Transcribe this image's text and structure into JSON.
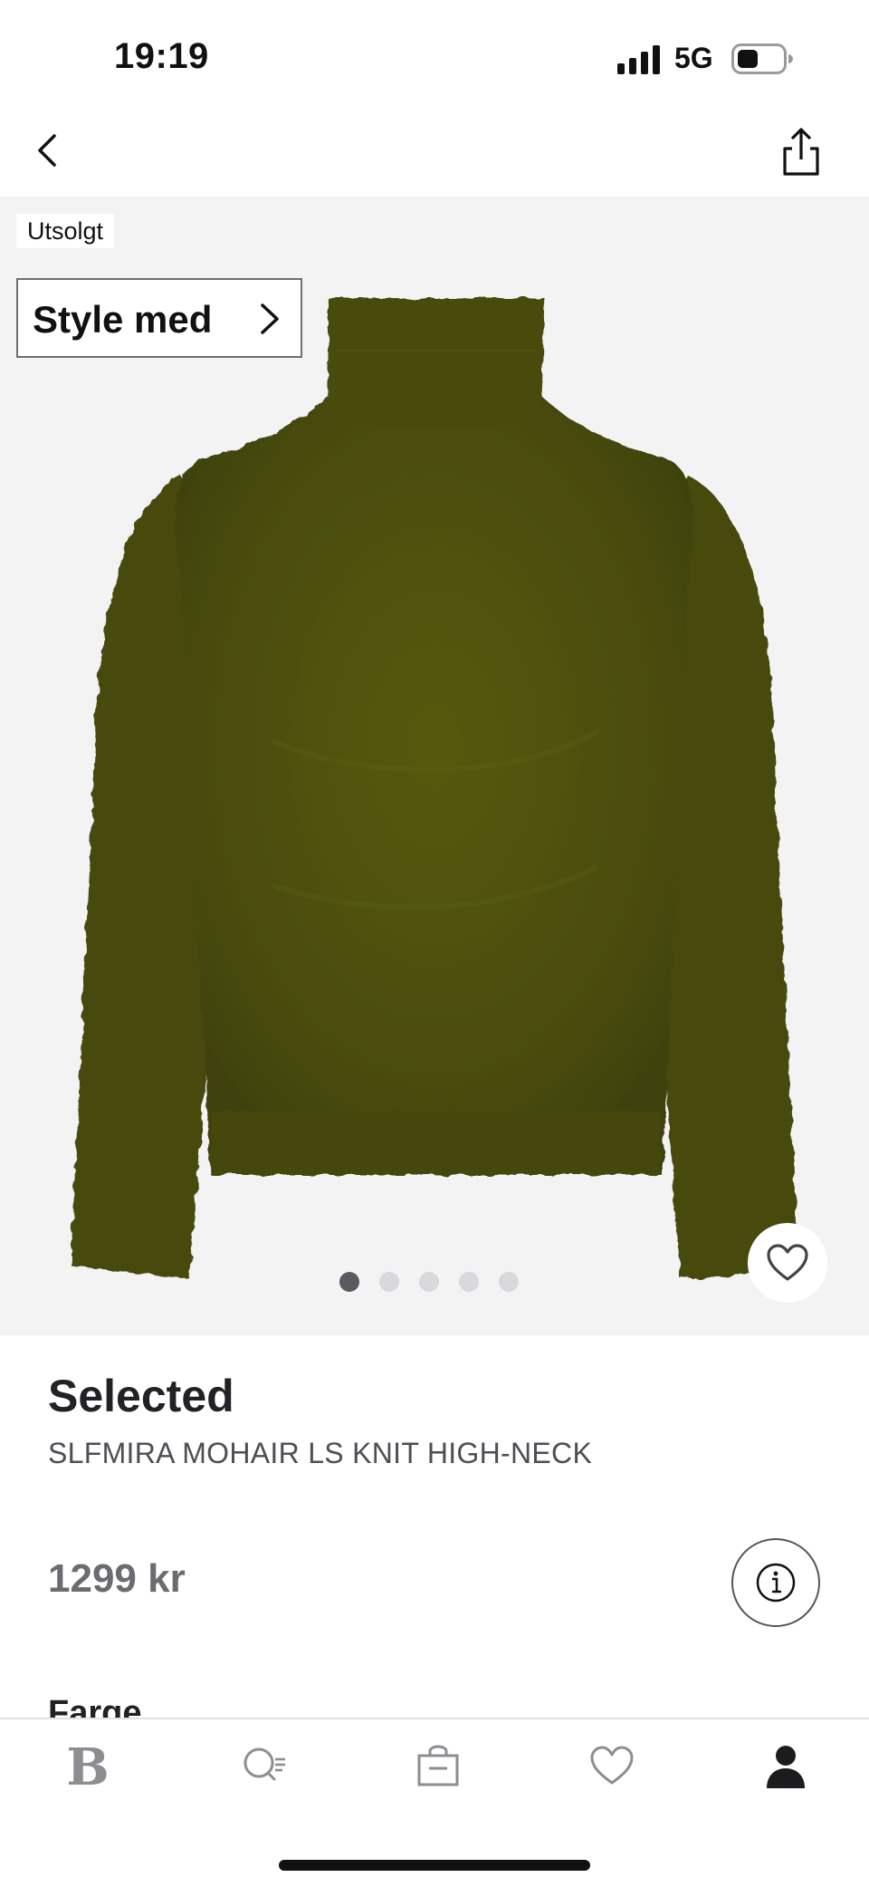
{
  "status_bar": {
    "time": "19:19",
    "network": "5G"
  },
  "product": {
    "badge": "Utsolgt",
    "style_with_label": "Style med",
    "brand": "Selected",
    "name": "SLFMIRA MOHAIR LS KNIT HIGH-NECK",
    "price": "1299 kr",
    "color_heading": "Farge",
    "image_count": 5,
    "active_image": 1,
    "garment_color": "#4f5210"
  },
  "nav": {
    "back_icon": "chevron-left-icon",
    "share_icon": "share-icon"
  },
  "tab_bar": {
    "items": [
      {
        "name": "home",
        "logo": "B",
        "active": false
      },
      {
        "name": "search",
        "icon": "search-icon",
        "active": false
      },
      {
        "name": "bag",
        "icon": "shopping-bag-icon",
        "active": false
      },
      {
        "name": "favorites",
        "icon": "heart-icon",
        "active": false
      },
      {
        "name": "profile",
        "icon": "person-icon",
        "active": true
      }
    ]
  }
}
